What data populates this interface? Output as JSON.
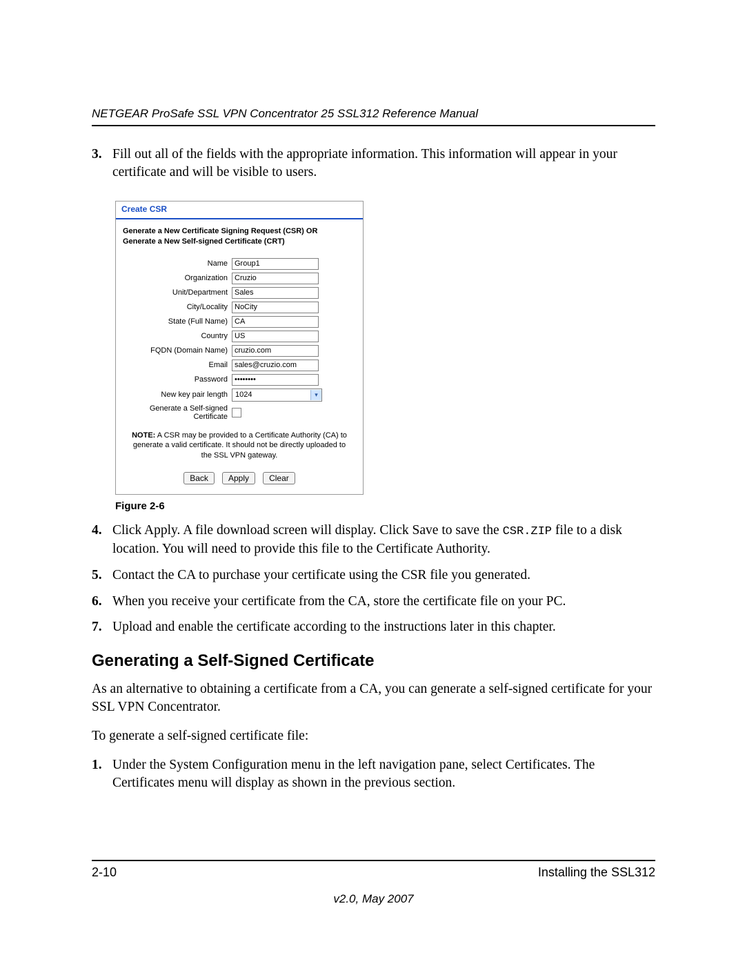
{
  "header": {
    "title": "NETGEAR ProSafe SSL VPN Concentrator 25 SSL312 Reference Manual"
  },
  "steps_a": {
    "s3_num": "3.",
    "s3": "Fill out all of the fields with the appropriate information. This information will appear in your certificate and will be visible to users."
  },
  "figure": {
    "caption": "Figure 2-6"
  },
  "csr": {
    "title": "Create CSR",
    "subtitle_l1": "Generate a New Certificate Signing Request (CSR) OR",
    "subtitle_l2": "Generate a New Self-signed Certificate (CRT)",
    "labels": {
      "name": "Name",
      "org": "Organization",
      "unit": "Unit/Department",
      "city": "City/Locality",
      "state": "State (Full Name)",
      "country": "Country",
      "fqdn": "FQDN (Domain Name)",
      "email": "Email",
      "password": "Password",
      "keylen": "New key pair length",
      "selfsigned": "Generate a Self-signed Certificate"
    },
    "values": {
      "name": "Group1",
      "org": "Cruzio",
      "unit": "Sales",
      "city": "NoCity",
      "state": "CA",
      "country": "US",
      "fqdn": "cruzio.com",
      "email": "sales@cruzio.com",
      "password": "••••••••",
      "keylen": "1024"
    },
    "note_b": "NOTE:",
    "note": " A CSR may be provided to a Certificate Authority (CA) to generate a valid certificate. It should not be directly uploaded to the SSL VPN gateway.",
    "buttons": {
      "back": "Back",
      "apply": "Apply",
      "clear": "Clear"
    }
  },
  "steps_b": {
    "s4_num": "4.",
    "s4_a": "Click Apply. A file download screen will display. Click Save to save the ",
    "s4_code": "CSR.ZIP",
    "s4_b": " file to a disk location. You will need to provide this file to the Certificate Authority.",
    "s5_num": "5.",
    "s5": "Contact the CA to purchase your certificate using the CSR file you generated.",
    "s6_num": "6.",
    "s6": "When you receive your certificate from the CA, store the certificate file on your PC.",
    "s7_num": "7.",
    "s7": "Upload and enable the certificate according to the instructions later in this chapter."
  },
  "section": {
    "title": "Generating a Self-Signed Certificate",
    "p1": "As an alternative to obtaining a certificate from a CA, you can generate a self-signed certificate for your SSL VPN Concentrator.",
    "p2": "To generate a self-signed certificate file:"
  },
  "steps_c": {
    "s1_num": "1.",
    "s1": "Under the System Configuration menu in the left navigation pane, select Certificates. The Certificates menu will display as shown in the previous section."
  },
  "footer": {
    "page": "2-10",
    "chapter": "Installing the SSL312",
    "version": "v2.0, May 2007"
  }
}
